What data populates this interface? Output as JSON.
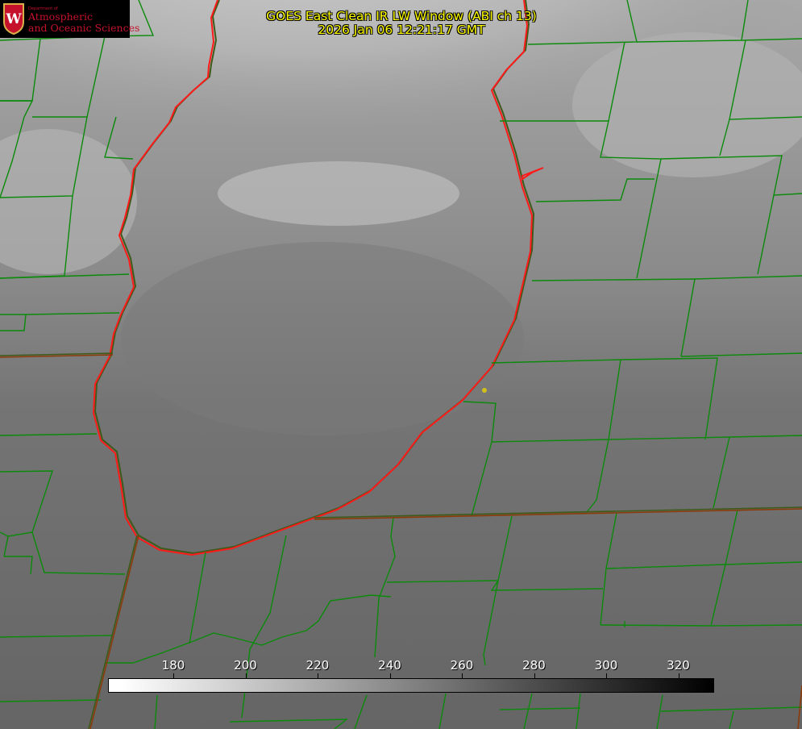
{
  "header": {
    "title_line1": "GOES East Clean IR LW Window (ABI ch 13)",
    "title_line2": "2026 Jan 06 12:21:17 GMT",
    "title_color": "#ffff00"
  },
  "logo": {
    "dept": "Department of",
    "line1": "Atmospheric",
    "line2": "and Oceanic Sciences",
    "color": "#c5112c"
  },
  "colorbar": {
    "ticks": [
      "180",
      "200",
      "220",
      "240",
      "260",
      "280",
      "300",
      "320"
    ],
    "gradient": [
      "#ffffff",
      "#000000"
    ]
  },
  "colors": {
    "shoreline": "#ff1a1a",
    "county_lines": "#0b8a0b",
    "state_lines": "#8b3a0a",
    "marker": "#d4c01a"
  }
}
